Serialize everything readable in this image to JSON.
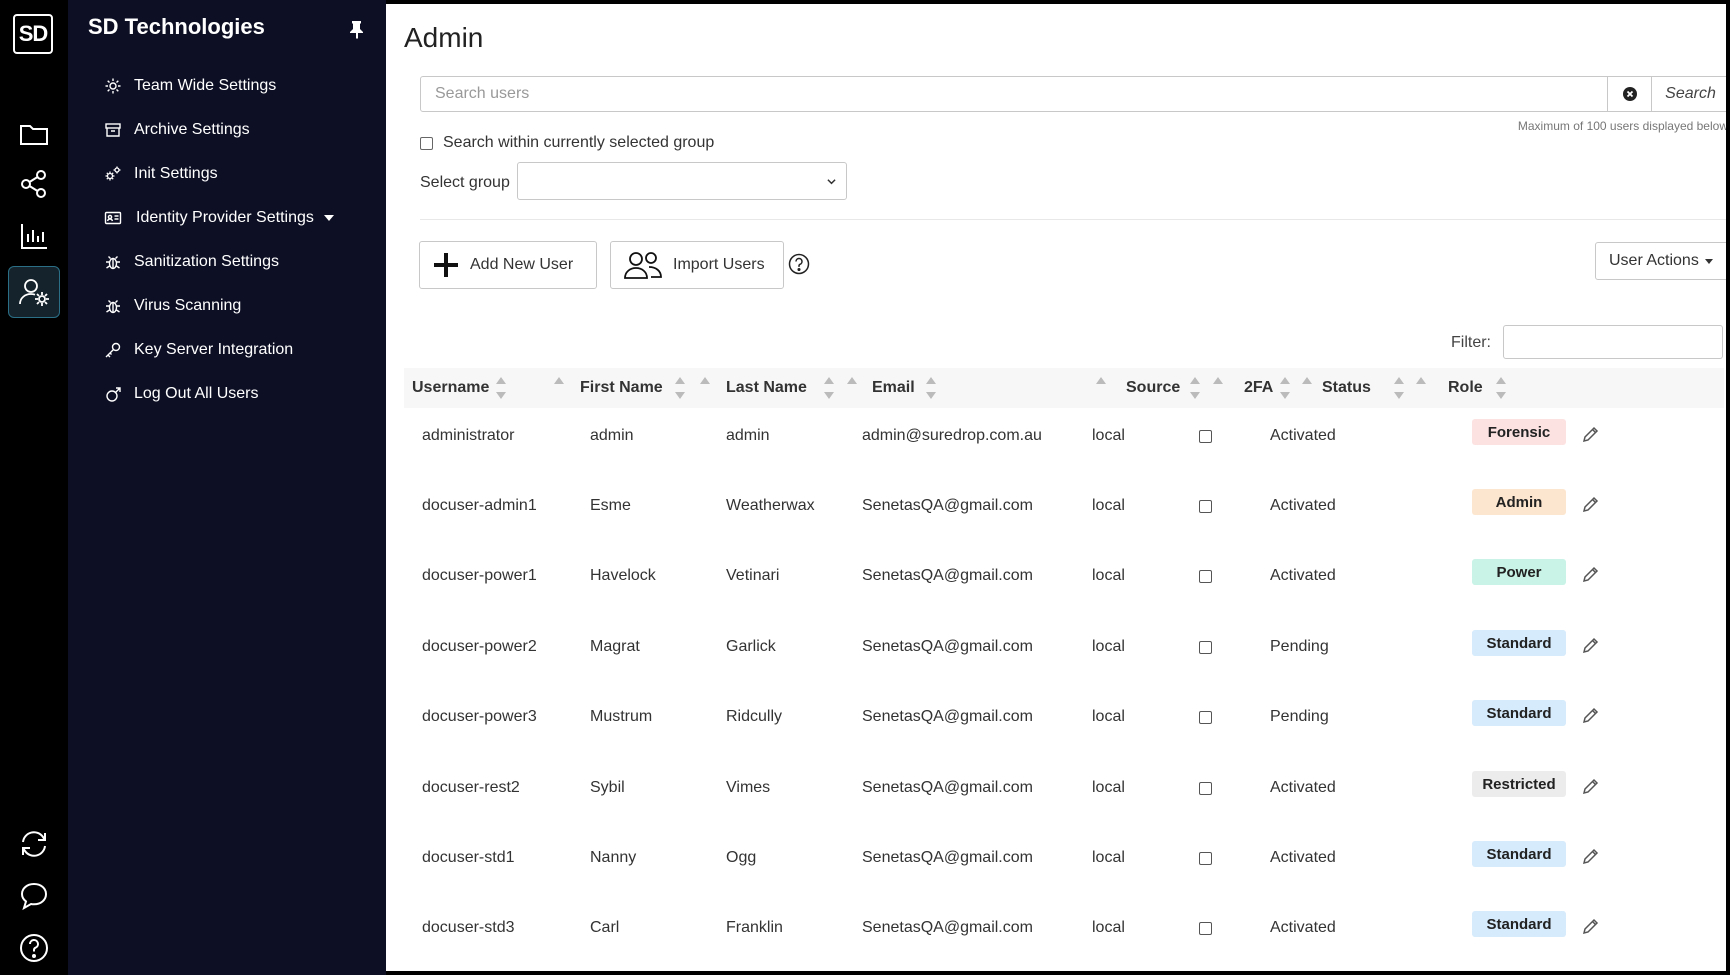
{
  "app": {
    "logo_text": "SD",
    "brand": "SD Technologies"
  },
  "rail": {
    "items": [
      {
        "icon": "folder-icon"
      },
      {
        "icon": "share-icon"
      },
      {
        "icon": "bar-chart-icon"
      },
      {
        "icon": "user-settings-icon",
        "active": true
      },
      {
        "icon": "sync-icon"
      },
      {
        "icon": "chat-icon"
      },
      {
        "icon": "help-icon"
      }
    ]
  },
  "sidebar": {
    "items": [
      {
        "label": "Team Wide Settings",
        "icon": "gear-icon"
      },
      {
        "label": "Archive Settings",
        "icon": "archive-icon"
      },
      {
        "label": "Init Settings",
        "icon": "gears-icon"
      },
      {
        "label": "Identity Provider Settings",
        "icon": "id-card-icon"
      },
      {
        "label": "Sanitization Settings",
        "icon": "bug-icon"
      },
      {
        "label": "Virus Scanning",
        "icon": "bug-icon"
      },
      {
        "label": "Key Server Integration",
        "icon": "key-icon"
      },
      {
        "label": "Log Out All Users",
        "icon": "logout-icon"
      }
    ]
  },
  "page": {
    "title": "Admin",
    "search_placeholder": "Search users",
    "search_button": "Search",
    "max_note": "Maximum of 100 users displayed below",
    "group_check_label": "Search within currently selected group",
    "select_group_label": "Select group",
    "select_group_value": "",
    "add_user": "Add New User",
    "import_users": "Import Users",
    "user_actions": "User Actions",
    "filter_label": "Filter:"
  },
  "table": {
    "headers": [
      "Username",
      "First Name",
      "Last Name",
      "Email",
      "Source",
      "2FA",
      "Status",
      "Role"
    ],
    "rows": [
      {
        "username": "administrator",
        "first": "admin",
        "last": "admin",
        "email": "admin@suredrop.com.au",
        "source": "local",
        "status": "Activated",
        "role": "Forensic",
        "role_color": "#fde2e2"
      },
      {
        "username": "docuser-admin1",
        "first": "Esme",
        "last": "Weatherwax",
        "email": "SenetasQA@gmail.com",
        "source": "local",
        "status": "Activated",
        "role": "Admin",
        "role_color": "#fde6cf"
      },
      {
        "username": "docuser-power1",
        "first": "Havelock",
        "last": "Vetinari",
        "email": "SenetasQA@gmail.com",
        "source": "local",
        "status": "Activated",
        "role": "Power",
        "role_color": "#c8f3e6"
      },
      {
        "username": "docuser-power2",
        "first": "Magrat",
        "last": "Garlick",
        "email": "SenetasQA@gmail.com",
        "source": "local",
        "status": "Pending",
        "role": "Standard",
        "role_color": "#d6ebfb"
      },
      {
        "username": "docuser-power3",
        "first": "Mustrum",
        "last": "Ridcully",
        "email": "SenetasQA@gmail.com",
        "source": "local",
        "status": "Pending",
        "role": "Standard",
        "role_color": "#d6ebfb"
      },
      {
        "username": "docuser-rest2",
        "first": "Sybil",
        "last": "Vimes",
        "email": "SenetasQA@gmail.com",
        "source": "local",
        "status": "Activated",
        "role": "Restricted",
        "role_color": "#ececec"
      },
      {
        "username": "docuser-std1",
        "first": "Nanny",
        "last": "Ogg",
        "email": "SenetasQA@gmail.com",
        "source": "local",
        "status": "Activated",
        "role": "Standard",
        "role_color": "#d6ebfb"
      },
      {
        "username": "docuser-std3",
        "first": "Carl",
        "last": "Franklin",
        "email": "SenetasQA@gmail.com",
        "source": "local",
        "status": "Activated",
        "role": "Standard",
        "role_color": "#d6ebfb"
      }
    ]
  }
}
